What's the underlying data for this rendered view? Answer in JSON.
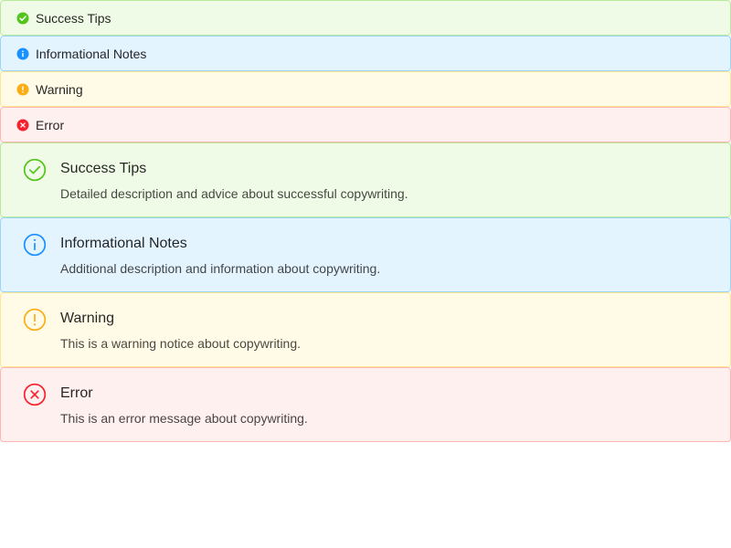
{
  "compact_alerts": [
    {
      "type": "success",
      "message": "Success Tips",
      "icon": "check-circle-filled-icon",
      "color": "#52c41a"
    },
    {
      "type": "info",
      "message": "Informational Notes",
      "icon": "info-circle-filled-icon",
      "color": "#1890ff"
    },
    {
      "type": "warning",
      "message": "Warning",
      "icon": "exclamation-circle-filled-icon",
      "color": "#faad14"
    },
    {
      "type": "error",
      "message": "Error",
      "icon": "close-circle-filled-icon",
      "color": "#f5222d"
    }
  ],
  "detailed_alerts": [
    {
      "type": "success",
      "title": "Success Tips",
      "description": "Detailed description and advice about successful copywriting.",
      "icon": "check-circle-outline-icon",
      "color": "#52c41a"
    },
    {
      "type": "info",
      "title": "Informational Notes",
      "description": "Additional description and information about copywriting.",
      "icon": "info-circle-outline-icon",
      "color": "#1890ff"
    },
    {
      "type": "warning",
      "title": "Warning",
      "description": "This is a warning notice about copywriting.",
      "icon": "exclamation-circle-outline-icon",
      "color": "#faad14"
    },
    {
      "type": "error",
      "title": "Error",
      "description": "This is an error message about copywriting.",
      "icon": "close-circle-outline-icon",
      "color": "#f5222d"
    }
  ]
}
